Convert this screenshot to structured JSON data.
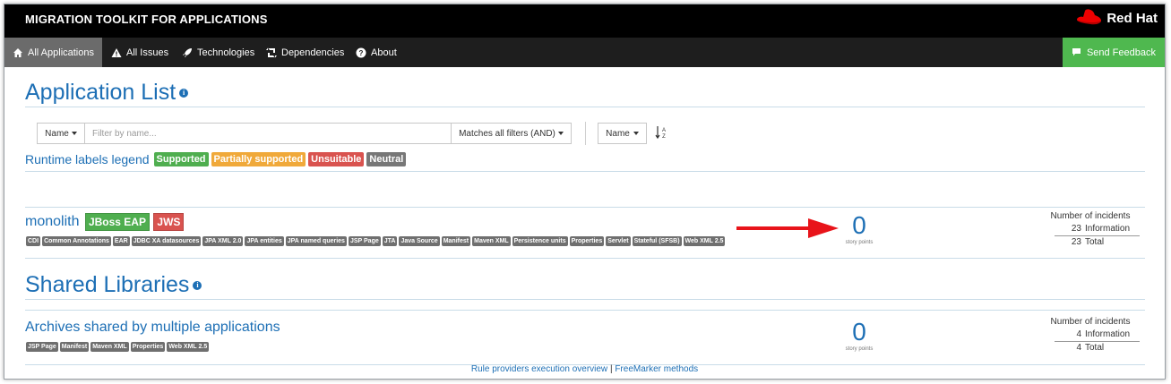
{
  "header": {
    "app_title": "MIGRATION TOOLKIT FOR APPLICATIONS",
    "brand": "Red Hat",
    "brand_color": "#ee0000"
  },
  "nav": {
    "items": [
      {
        "label": "All Applications",
        "icon": "home-icon",
        "active": true
      },
      {
        "label": "All Issues",
        "icon": "warning-icon",
        "active": false
      },
      {
        "label": "Technologies",
        "icon": "rocket-icon",
        "active": false
      },
      {
        "label": "Dependencies",
        "icon": "retweet-icon",
        "active": false
      },
      {
        "label": "About",
        "icon": "question-icon",
        "active": false
      }
    ],
    "feedback_label": "Send Feedback",
    "feedback_color": "#4fb84f"
  },
  "page": {
    "title": "Application List"
  },
  "filter": {
    "name_label": "Name",
    "placeholder": "Filter by name...",
    "match_label": "Matches all filters (AND)",
    "sort_label": "Name",
    "sort_icon": "sort-alpha-icon"
  },
  "legend": {
    "title": "Runtime labels legend",
    "items": [
      "Supported",
      "Partially supported",
      "Unsuitable",
      "Neutral"
    ]
  },
  "application": {
    "name": "monolith",
    "runtimes": [
      "JBoss EAP",
      "JWS"
    ],
    "tags": [
      "CDI",
      "Common Annotations",
      "EAR",
      "JDBC XA datasources",
      "JPA XML 2.0",
      "JPA entities",
      "JPA named queries",
      "JSP Page",
      "JTA",
      "Java Source",
      "Manifest",
      "Maven XML",
      "Persistence units",
      "Properties",
      "Servlet",
      "Stateful (SFSB)",
      "Web XML 2.5"
    ],
    "story_points": "0",
    "story_points_label": "story points",
    "incidents_header": "Number of incidents",
    "incidents": [
      {
        "count": "23",
        "label": "Information"
      }
    ],
    "total_count": "23",
    "total_label": "Total"
  },
  "shared": {
    "title": "Shared Libraries",
    "name": "Archives shared by multiple applications",
    "tags": [
      "JSP Page",
      "Manifest",
      "Maven XML",
      "Properties",
      "Web XML 2.5"
    ],
    "story_points": "0",
    "story_points_label": "story points",
    "incidents_header": "Number of incidents",
    "incidents": [
      {
        "count": "4",
        "label": "Information"
      }
    ],
    "total_count": "4",
    "total_label": "Total"
  },
  "footer": {
    "link1": "Rule providers execution overview",
    "separator": "|",
    "link2": "FreeMarker methods"
  },
  "annotation": {
    "arrow_color": "#e8141a"
  }
}
